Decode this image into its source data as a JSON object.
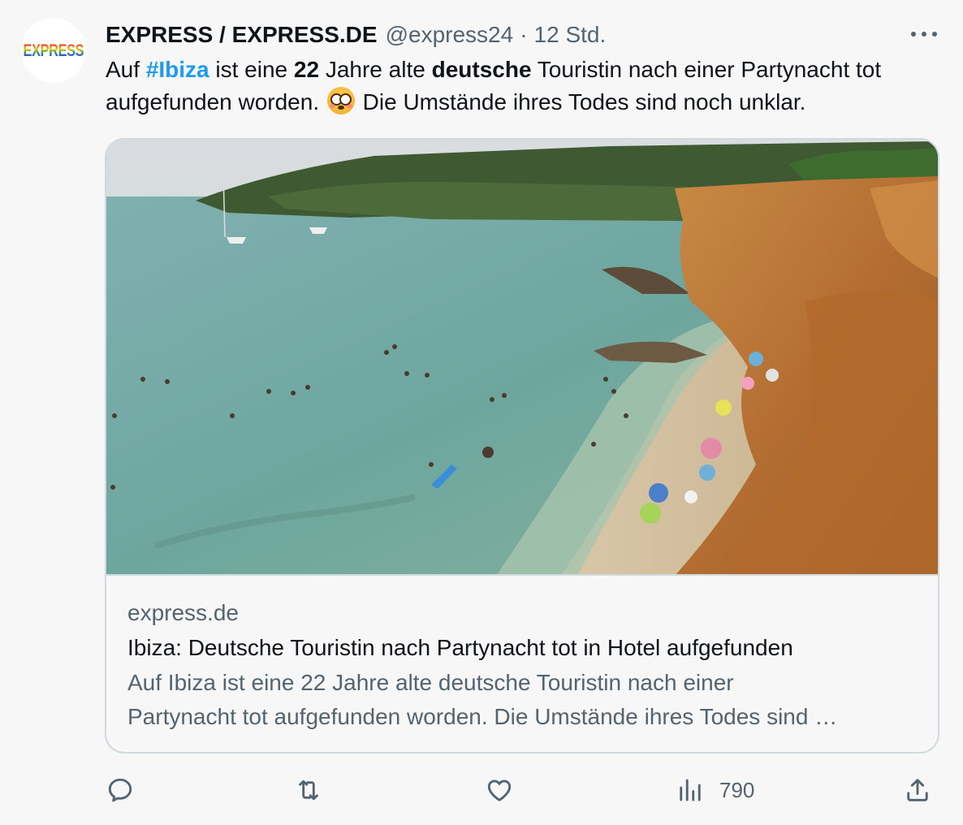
{
  "author": {
    "avatar_text": "EXPRESS",
    "name": "EXPRESS / EXPRESS.DE",
    "handle": "@express24",
    "separator": "·",
    "time": "12 Std."
  },
  "tweet": {
    "text": {
      "part1": "Auf ",
      "hashtag": "#Ibiza",
      "part2": " ist eine ",
      "bold1": "22",
      "part3": " Jahre alte ",
      "bold2": "deutsche",
      "part4": " Touristin nach einer Partynacht tot aufgefunden worden. ",
      "part5": " Die Umstände ihres Todes sind noch unklar."
    }
  },
  "card": {
    "domain": "express.de",
    "title": "Ibiza: Deutsche Touristin nach Partynacht tot in Hotel aufgefunden",
    "description_line1": "Auf Ibiza ist eine 22 Jahre alte deutsche Touristin nach einer",
    "description_line2": "Partynacht tot aufgefunden worden. Die Umstände ihres Todes sind …"
  },
  "actions": {
    "reply_icon": "reply-icon",
    "retweet_icon": "retweet-icon",
    "like_icon": "heart-icon",
    "views_icon": "views-chart-icon",
    "views_count": "790",
    "share_icon": "share-icon"
  },
  "colors": {
    "link": "#1d9bf0",
    "secondary_text": "#536471",
    "border": "#cfd9de",
    "background": "#f7f7f7"
  }
}
